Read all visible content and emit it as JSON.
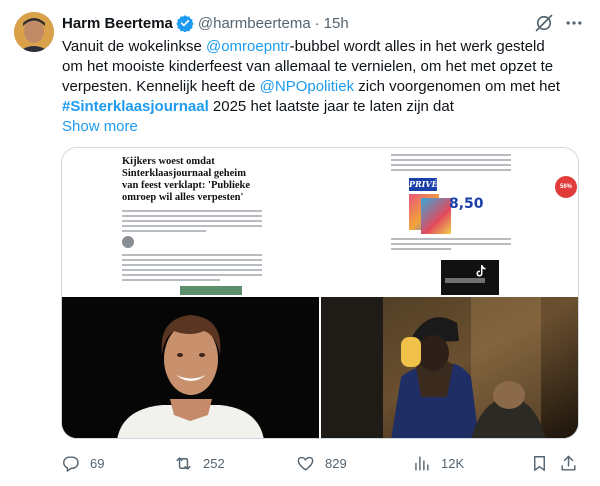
{
  "author": {
    "name": "Harm Beertema",
    "handle": "@harmbeertema",
    "separator": "·",
    "time": "15h"
  },
  "tweet": {
    "lines": [
      [
        {
          "t": "text",
          "v": "Vanuit de wokelinkse "
        },
        {
          "t": "mention",
          "v": "@omroepntr"
        },
        {
          "t": "text",
          "v": "-bubbel wordt alles in het werk gesteld"
        }
      ],
      [
        {
          "t": "text",
          "v": "om het mooiste kinderfeest van allemaal te vernielen, om het met opzet te"
        }
      ],
      [
        {
          "t": "text",
          "v": "verpesten. Kennelijk heeft de "
        },
        {
          "t": "mention",
          "v": "@NPOpolitiek"
        },
        {
          "t": "text",
          "v": " zich voorgenomen om met het"
        }
      ],
      [
        {
          "t": "hashtag",
          "v": "#Sinterklaasjournaal"
        },
        {
          "t": "text",
          "v": " 2025 het laatste jaar te laten zijn dat"
        }
      ]
    ],
    "show_more": "Show more"
  },
  "media": {
    "article_headline": "Kijkers woest omdat Sinterklaasjournaal geheim van feest verklapt: 'Publieke omroep wil alles verpesten'",
    "magazine_logo": "PRIVÉ",
    "magazine_price": "8,50",
    "discount_badge": "56%"
  },
  "stats": {
    "replies": "69",
    "retweets": "252",
    "likes": "829",
    "views": "12K"
  },
  "colors": {
    "accent": "#1d9bf0",
    "secondary_text": "#536471",
    "text": "#0f1419",
    "border": "#cfd9de"
  }
}
